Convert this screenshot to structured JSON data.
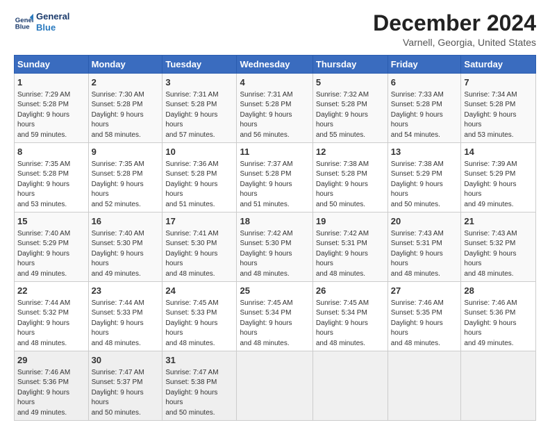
{
  "header": {
    "logo_line1": "General",
    "logo_line2": "Blue",
    "title": "December 2024",
    "subtitle": "Varnell, Georgia, United States"
  },
  "days_of_week": [
    "Sunday",
    "Monday",
    "Tuesday",
    "Wednesday",
    "Thursday",
    "Friday",
    "Saturday"
  ],
  "weeks": [
    [
      {
        "day": "1",
        "sunrise": "7:29 AM",
        "sunset": "5:28 PM",
        "daylight": "9 hours and 59 minutes."
      },
      {
        "day": "2",
        "sunrise": "7:30 AM",
        "sunset": "5:28 PM",
        "daylight": "9 hours and 58 minutes."
      },
      {
        "day": "3",
        "sunrise": "7:31 AM",
        "sunset": "5:28 PM",
        "daylight": "9 hours and 57 minutes."
      },
      {
        "day": "4",
        "sunrise": "7:31 AM",
        "sunset": "5:28 PM",
        "daylight": "9 hours and 56 minutes."
      },
      {
        "day": "5",
        "sunrise": "7:32 AM",
        "sunset": "5:28 PM",
        "daylight": "9 hours and 55 minutes."
      },
      {
        "day": "6",
        "sunrise": "7:33 AM",
        "sunset": "5:28 PM",
        "daylight": "9 hours and 54 minutes."
      },
      {
        "day": "7",
        "sunrise": "7:34 AM",
        "sunset": "5:28 PM",
        "daylight": "9 hours and 53 minutes."
      }
    ],
    [
      {
        "day": "8",
        "sunrise": "7:35 AM",
        "sunset": "5:28 PM",
        "daylight": "9 hours and 53 minutes."
      },
      {
        "day": "9",
        "sunrise": "7:35 AM",
        "sunset": "5:28 PM",
        "daylight": "9 hours and 52 minutes."
      },
      {
        "day": "10",
        "sunrise": "7:36 AM",
        "sunset": "5:28 PM",
        "daylight": "9 hours and 51 minutes."
      },
      {
        "day": "11",
        "sunrise": "7:37 AM",
        "sunset": "5:28 PM",
        "daylight": "9 hours and 51 minutes."
      },
      {
        "day": "12",
        "sunrise": "7:38 AM",
        "sunset": "5:28 PM",
        "daylight": "9 hours and 50 minutes."
      },
      {
        "day": "13",
        "sunrise": "7:38 AM",
        "sunset": "5:29 PM",
        "daylight": "9 hours and 50 minutes."
      },
      {
        "day": "14",
        "sunrise": "7:39 AM",
        "sunset": "5:29 PM",
        "daylight": "9 hours and 49 minutes."
      }
    ],
    [
      {
        "day": "15",
        "sunrise": "7:40 AM",
        "sunset": "5:29 PM",
        "daylight": "9 hours and 49 minutes."
      },
      {
        "day": "16",
        "sunrise": "7:40 AM",
        "sunset": "5:30 PM",
        "daylight": "9 hours and 49 minutes."
      },
      {
        "day": "17",
        "sunrise": "7:41 AM",
        "sunset": "5:30 PM",
        "daylight": "9 hours and 48 minutes."
      },
      {
        "day": "18",
        "sunrise": "7:42 AM",
        "sunset": "5:30 PM",
        "daylight": "9 hours and 48 minutes."
      },
      {
        "day": "19",
        "sunrise": "7:42 AM",
        "sunset": "5:31 PM",
        "daylight": "9 hours and 48 minutes."
      },
      {
        "day": "20",
        "sunrise": "7:43 AM",
        "sunset": "5:31 PM",
        "daylight": "9 hours and 48 minutes."
      },
      {
        "day": "21",
        "sunrise": "7:43 AM",
        "sunset": "5:32 PM",
        "daylight": "9 hours and 48 minutes."
      }
    ],
    [
      {
        "day": "22",
        "sunrise": "7:44 AM",
        "sunset": "5:32 PM",
        "daylight": "9 hours and 48 minutes."
      },
      {
        "day": "23",
        "sunrise": "7:44 AM",
        "sunset": "5:33 PM",
        "daylight": "9 hours and 48 minutes."
      },
      {
        "day": "24",
        "sunrise": "7:45 AM",
        "sunset": "5:33 PM",
        "daylight": "9 hours and 48 minutes."
      },
      {
        "day": "25",
        "sunrise": "7:45 AM",
        "sunset": "5:34 PM",
        "daylight": "9 hours and 48 minutes."
      },
      {
        "day": "26",
        "sunrise": "7:45 AM",
        "sunset": "5:34 PM",
        "daylight": "9 hours and 48 minutes."
      },
      {
        "day": "27",
        "sunrise": "7:46 AM",
        "sunset": "5:35 PM",
        "daylight": "9 hours and 48 minutes."
      },
      {
        "day": "28",
        "sunrise": "7:46 AM",
        "sunset": "5:36 PM",
        "daylight": "9 hours and 49 minutes."
      }
    ],
    [
      {
        "day": "29",
        "sunrise": "7:46 AM",
        "sunset": "5:36 PM",
        "daylight": "9 hours and 49 minutes."
      },
      {
        "day": "30",
        "sunrise": "7:47 AM",
        "sunset": "5:37 PM",
        "daylight": "9 hours and 50 minutes."
      },
      {
        "day": "31",
        "sunrise": "7:47 AM",
        "sunset": "5:38 PM",
        "daylight": "9 hours and 50 minutes."
      },
      null,
      null,
      null,
      null
    ]
  ]
}
